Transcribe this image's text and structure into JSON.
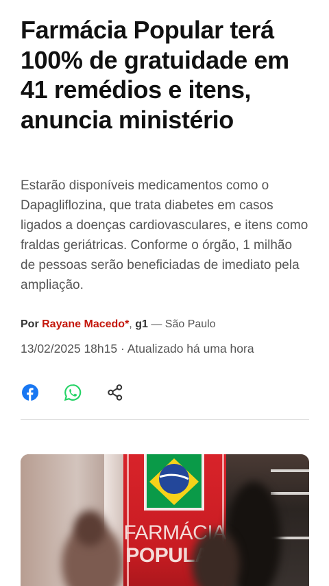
{
  "article": {
    "headline": "Farmácia Popular terá 100% de gratuidade em 41 remédios e itens, anuncia ministério",
    "subtitle": "Estarão disponíveis medicamentos como o Dapagliflozina, que trata diabetes em casos ligados a doenças cardiovasculares, e itens como fraldas geriátricas. Conforme o órgão, 1 milhão de pessoas serão beneficiadas de imediato pela ampliação.",
    "byline": {
      "prefix": "Por",
      "author": "Rayane Macedo*",
      "separator": ",",
      "outlet": "g1",
      "location": "— São Paulo"
    },
    "dateline": {
      "published": "13/02/2025 18h15",
      "updated": "· Atualizado há uma hora"
    }
  },
  "share": {
    "buttons": [
      {
        "icon": "facebook-icon",
        "color": "#1877f2"
      },
      {
        "icon": "whatsapp-icon",
        "color": "#25d366"
      },
      {
        "icon": "share-icon",
        "color": "#333333"
      }
    ]
  },
  "photo": {
    "sign_line1": "FARMÁCIA",
    "sign_line2": "POPULAR"
  }
}
